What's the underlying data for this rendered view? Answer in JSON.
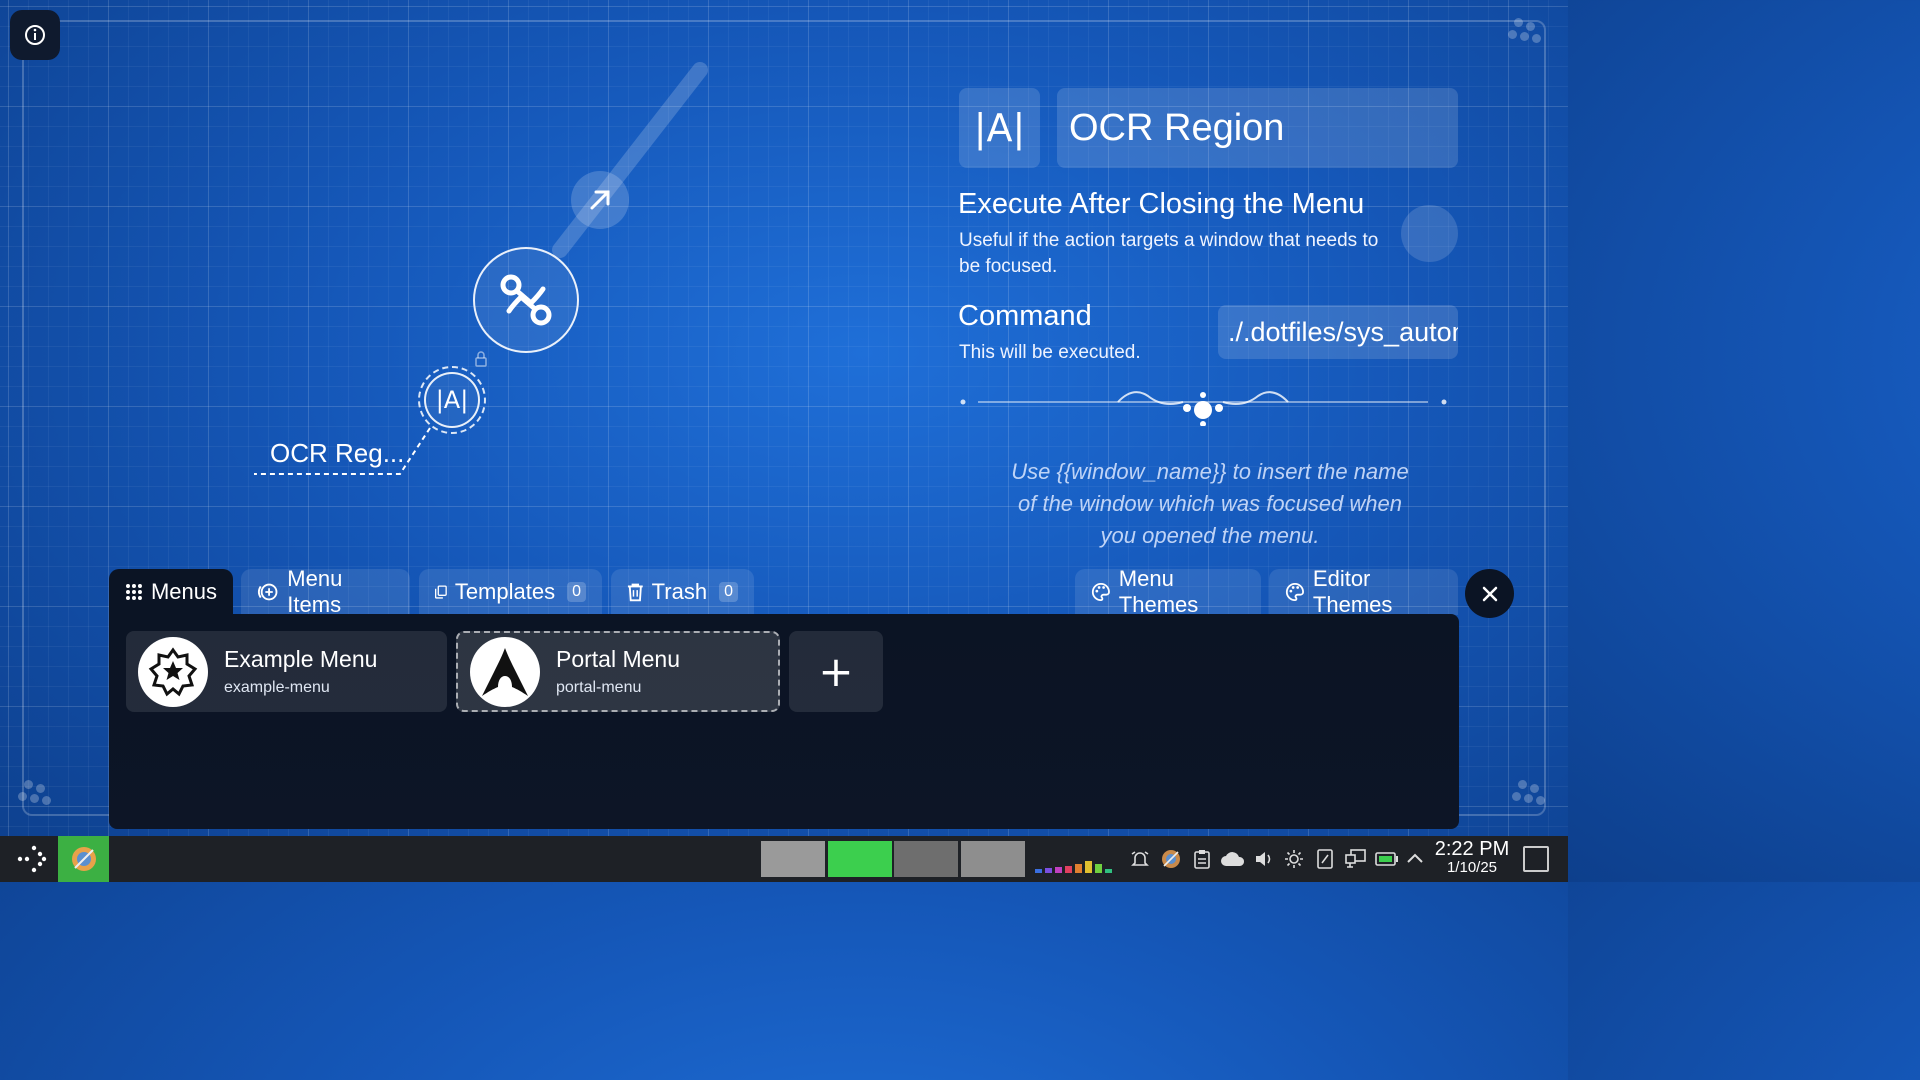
{
  "preview": {
    "child_label": "OCR Reg...",
    "child_icon_text": "|A|"
  },
  "properties": {
    "icon_text": "|A|",
    "name": "OCR Region",
    "execute_after_title": "Execute After Closing the Menu",
    "execute_after_desc": "Useful if the action targets a window that needs to be focused.",
    "command_title": "Command",
    "command_desc": "This will be executed.",
    "command_value": "./.dotfiles/sys_autom",
    "hint": "Use {{window_name}} to insert the name of the window which was focused when you opened the menu."
  },
  "tabs": {
    "menus": "Menus",
    "menu_items": "Menu Items",
    "templates": "Templates",
    "templates_count": "0",
    "trash": "Trash",
    "trash_count": "0",
    "menu_themes": "Menu Themes",
    "editor_themes": "Editor Themes"
  },
  "menus": [
    {
      "name": "Example Menu",
      "id": "example-menu",
      "icon": "star-gear-icon"
    },
    {
      "name": "Portal Menu",
      "id": "portal-menu",
      "icon": "arch-linux-icon",
      "selected": true
    }
  ],
  "add_label": "+",
  "taskbar": {
    "time": "2:22 PM",
    "date": "1/10/25",
    "pager_colors": [
      "#9a9a9a",
      "#3ccf4e",
      "#6e6e6e",
      "#8e8e8e"
    ]
  },
  "colors": {
    "background": "#1557b8",
    "panel": "#0b1424",
    "active_desktop": "#3ccf4e"
  }
}
